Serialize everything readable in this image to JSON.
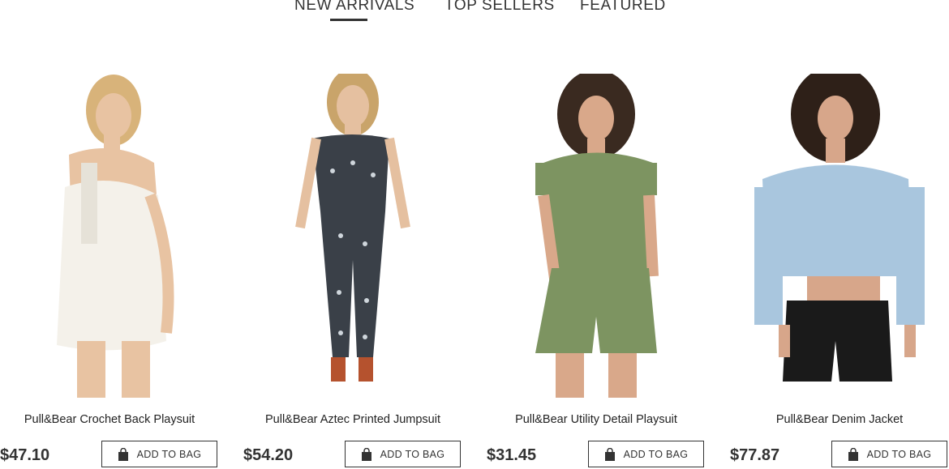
{
  "tabs": {
    "new_arrivals": "NEW ARRIVALS",
    "top_sellers": "TOP SELLERS",
    "featured": "FEATURED",
    "active": "new_arrivals"
  },
  "products": [
    {
      "name": "Pull&Bear Crochet Back Playsuit",
      "price": "$47.10",
      "button": "ADD TO BAG",
      "garment_color": "#f4f1ea"
    },
    {
      "name": "Pull&Bear Aztec Printed Jumpsuit",
      "price": "$54.20",
      "button": "ADD TO BAG",
      "garment_color": "#3a4048"
    },
    {
      "name": "Pull&Bear Utility Detail Playsuit",
      "price": "$31.45",
      "button": "ADD TO BAG",
      "garment_color": "#7d9461"
    },
    {
      "name": "Pull&Bear Denim Jacket",
      "price": "$77.87",
      "button": "ADD TO BAG",
      "garment_color": "#a9c6de"
    }
  ],
  "colors": {
    "text": "#333333",
    "button_border": "#333333"
  }
}
